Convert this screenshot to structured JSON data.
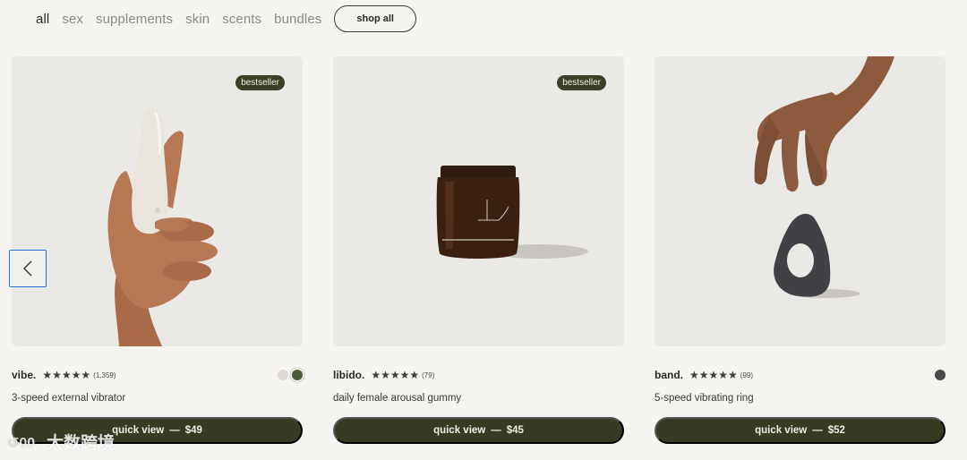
{
  "filters": {
    "items": [
      "all",
      "sex",
      "supplements",
      "skin",
      "scents",
      "bundles"
    ],
    "shop_all": "shop all"
  },
  "products": [
    {
      "badge": "bestseller",
      "name": "vibe.",
      "stars": "★★★★★",
      "rating": 5,
      "reviews": "(1,359)",
      "description": "3-speed external vibrator",
      "quick_view": "quick view",
      "dash": "—",
      "price": "$49",
      "swatch_colors": [
        "#e0d9d1",
        "#4b5a38"
      ]
    },
    {
      "badge": "bestseller",
      "name": "libido.",
      "stars": "★★★★★",
      "rating": 4.5,
      "reviews": "(79)",
      "description": "daily female arousal gummy",
      "quick_view": "quick view",
      "dash": "—",
      "price": "$45",
      "swatch_colors": []
    },
    {
      "badge": "",
      "name": "band.",
      "stars": "★★★★★",
      "rating": 5,
      "reviews": "(99)",
      "description": "5-speed vibrating ring",
      "quick_view": "quick view",
      "dash": "—",
      "price": "$52",
      "swatch_colors": [
        "#48494b"
      ]
    }
  ],
  "carousel": {
    "prev_icon": "chevron-left-icon"
  },
  "watermark": {
    "text": "大数跨境"
  },
  "colors": {
    "button_bg": "#383a24",
    "badge_bg": "#3c3e27",
    "prev_border": "#2f6bd8"
  }
}
